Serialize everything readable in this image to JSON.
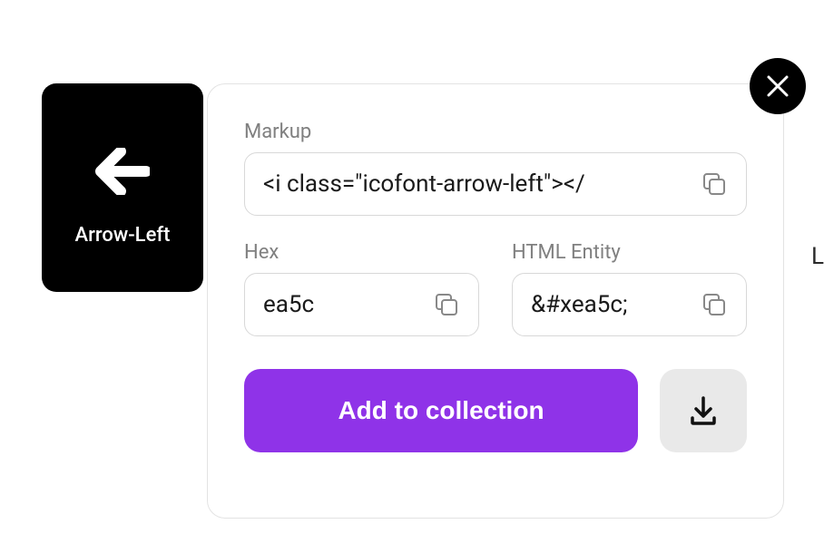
{
  "icon": {
    "name": "Arrow-Left"
  },
  "fields": {
    "markup": {
      "label": "Markup",
      "value": "<i class=\"icofont-arrow-left\"></"
    },
    "hex": {
      "label": "Hex",
      "value": "ea5c"
    },
    "html_entity": {
      "label": "HTML Entity",
      "value": "&#xea5c;"
    }
  },
  "actions": {
    "add_to_collection": "Add to collection"
  },
  "partial_text": "L",
  "colors": {
    "accent": "#8f33e8"
  }
}
